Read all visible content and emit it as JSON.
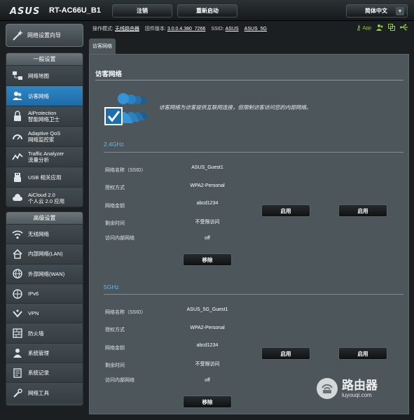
{
  "header": {
    "logo": "ASUS",
    "model": "RT-AC66U_B1",
    "logout_label": "注销",
    "reboot_label": "重新启动",
    "language": "简体中文"
  },
  "sidebar": {
    "quick_setup": "网络设置向导",
    "general_title": "一般设置",
    "general_items": [
      {
        "icon": "network-map-icon",
        "label": "网络地图",
        "label2": ""
      },
      {
        "icon": "guest-network-icon",
        "label": "访客网络",
        "label2": ""
      },
      {
        "icon": "aiprotection-icon",
        "label": "AiProtection",
        "label2": "智能网络卫士"
      },
      {
        "icon": "adaptive-qos-icon",
        "label": "Adaptive QoS",
        "label2": "网络监控家"
      },
      {
        "icon": "traffic-analyzer-icon",
        "label": "Traffic Analyzer",
        "label2": "流量分析"
      },
      {
        "icon": "usb-icon",
        "label": "USB 相关应用",
        "label2": ""
      },
      {
        "icon": "aicloud-icon",
        "label": "AiCloud 2.0",
        "label2": "个人云 2.0 应用"
      }
    ],
    "advanced_title": "高级设置",
    "advanced_items": [
      {
        "icon": "wireless-icon",
        "label": "无线网络"
      },
      {
        "icon": "lan-home-icon",
        "label": "内部网络(LAN)"
      },
      {
        "icon": "wan-globe-icon",
        "label": "外部网络(WAN)"
      },
      {
        "icon": "ipv6-icon",
        "label": "IPv6"
      },
      {
        "icon": "vpn-icon",
        "label": "VPN"
      },
      {
        "icon": "firewall-icon",
        "label": "防火墙"
      },
      {
        "icon": "admin-icon",
        "label": "系统管理"
      },
      {
        "icon": "log-icon",
        "label": "系统记录"
      },
      {
        "icon": "tools-icon",
        "label": "网络工具"
      }
    ]
  },
  "status": {
    "mode_label": "操作模式:",
    "mode_value": "无线路由器",
    "fw_label": "固件版本:",
    "fw_value": "3.0.0.4.380_7266",
    "ssid_label": "SSID:",
    "ssid1": "ASUS",
    "ssid2": "ASUS_5G",
    "app_label": "App"
  },
  "main": {
    "tab": "访客网络",
    "title": "访客网络",
    "description": "访客网络为访客提供互联网连接，但限制访客访问您的内部网络。",
    "band_24": {
      "title": "2.4GHz",
      "labels": [
        "网络名称（SSID）",
        "授权方式",
        "网络金钥",
        "剩余时间",
        "访问内部网络"
      ],
      "values": [
        "ASUS_Guest1",
        "WPA2-Personal",
        "abcd1234",
        "不受限访问",
        "off"
      ],
      "enable1": "启用",
      "enable2": "启用",
      "remove": "移除"
    },
    "band_5": {
      "title": "5GHz",
      "labels": [
        "网络名称（SSID）",
        "授权方式",
        "网络金钥",
        "剩余时间",
        "访问内部网络"
      ],
      "values": [
        "ASUS_5G_Guest1",
        "WPA2-Personal",
        "abcd1234",
        "不受限访问",
        "off"
      ],
      "enable1": "启用",
      "enable2": "启用",
      "remove": "移除"
    }
  },
  "watermark": {
    "main": "路由器",
    "sub": "luyouqi.com"
  },
  "colors": {
    "accent_blue": "#2d87c5",
    "band_title": "#6cb4e0",
    "status_green": "#8fd03a"
  }
}
